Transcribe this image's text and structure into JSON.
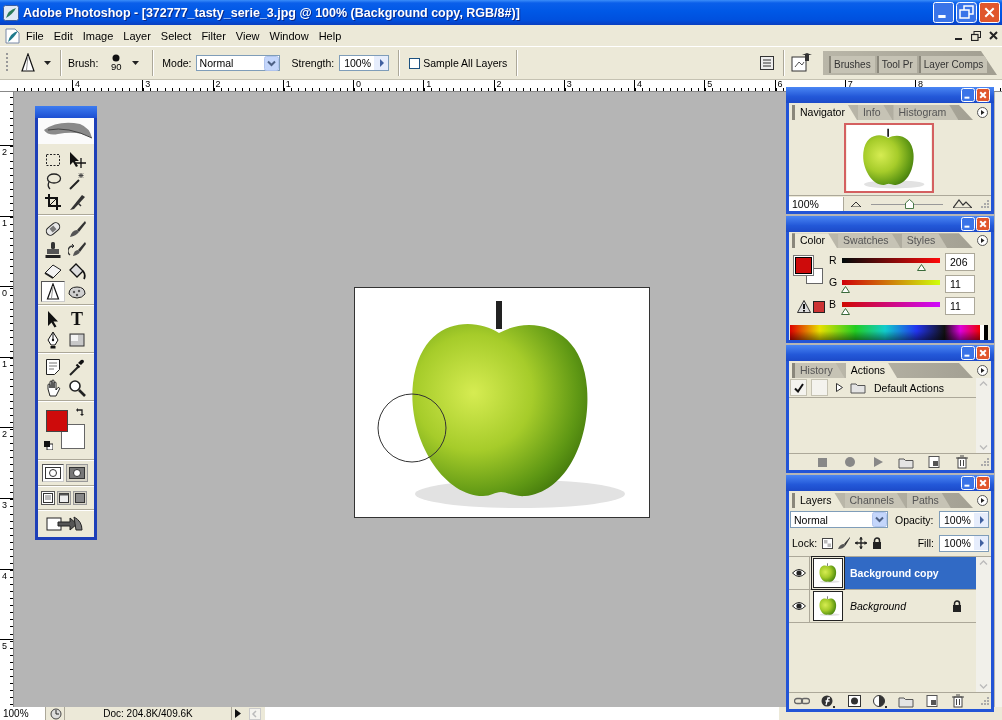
{
  "window": {
    "title": "Adobe Photoshop - [372777_tasty_serie_3.jpg @ 100% (Background copy, RGB/8#)]"
  },
  "menu_bar": {
    "items": [
      "File",
      "Edit",
      "Image",
      "Layer",
      "Select",
      "Filter",
      "View",
      "Window",
      "Help"
    ]
  },
  "options_bar": {
    "brush_label": "Brush:",
    "brush_size": "90",
    "mode_label": "Mode:",
    "mode": "Normal",
    "strength_label": "Strength:",
    "strength": "100%",
    "sample_all_layers": {
      "label": "Sample All Layers",
      "checked": false
    },
    "palette_well": {
      "tabs": [
        "Brushes",
        "Tool Pr",
        "Layer Comps"
      ]
    }
  },
  "rulers": {
    "horizontal": [
      "4",
      "3",
      "2",
      "1",
      "0",
      "1",
      "2",
      "3",
      "4",
      "5",
      "6",
      "7",
      "8"
    ],
    "vertical": [
      "2",
      "1",
      "0",
      "1",
      "2",
      "3",
      "4",
      "5"
    ]
  },
  "toolbox": {
    "tool_groups": [
      [
        {
          "kind": "marquee",
          "selected": false
        },
        {
          "kind": "move",
          "selected": false
        },
        {
          "kind": "lasso",
          "selected": false
        },
        {
          "kind": "wand",
          "selected": false
        },
        {
          "kind": "crop",
          "selected": false
        },
        {
          "kind": "slice",
          "selected": false
        }
      ],
      [
        {
          "kind": "healing",
          "selected": false
        },
        {
          "kind": "brush",
          "selected": false
        },
        {
          "kind": "stamp",
          "selected": false
        },
        {
          "kind": "history",
          "selected": false
        },
        {
          "kind": "eraser",
          "selected": false
        },
        {
          "kind": "bucket",
          "selected": false
        },
        {
          "kind": "sharpen",
          "selected": true
        },
        {
          "kind": "sponge",
          "selected": false
        }
      ],
      [
        {
          "kind": "pathselect",
          "selected": false
        },
        {
          "kind": "type",
          "selected": false,
          "glyph": "T"
        },
        {
          "kind": "pen",
          "selected": false
        },
        {
          "kind": "shape",
          "selected": false
        }
      ],
      [
        {
          "kind": "notes",
          "selected": false
        },
        {
          "kind": "eyedropper",
          "selected": false
        },
        {
          "kind": "hand",
          "selected": false
        },
        {
          "kind": "zoom",
          "selected": false
        }
      ]
    ],
    "colors": [
      {
        "kind": "foreground",
        "color": "#ce0b0b"
      },
      {
        "kind": "background",
        "color": "#ffffff"
      }
    ],
    "edit_modes": [
      {
        "kind": "standard",
        "selected": true
      },
      {
        "kind": "quickmask",
        "selected": false
      }
    ],
    "screen_modes": [
      {
        "kind": "window",
        "selected": true
      },
      {
        "kind": "fullmenu",
        "selected": false
      },
      {
        "kind": "full",
        "selected": false
      }
    ]
  },
  "navigator_panel": {
    "tabs": [
      {
        "label": "Navigator",
        "selected": true
      },
      {
        "label": "Info",
        "selected": false
      },
      {
        "label": "Histogram",
        "selected": false
      }
    ],
    "zoom": "100%",
    "zoom_slider": {
      "level": 0.53
    }
  },
  "color_panel": {
    "tabs": [
      {
        "label": "Color",
        "selected": true
      },
      {
        "label": "Swatches",
        "selected": false
      },
      {
        "label": "Styles",
        "selected": false
      }
    ],
    "swatches": [
      {
        "kind": "foreground",
        "color": "#ce0b0b"
      },
      {
        "kind": "background",
        "color": "#ffffff"
      }
    ],
    "channels": [
      {
        "name": "R",
        "level": 0.81,
        "value": "206"
      },
      {
        "name": "G",
        "level": 0.04,
        "value": "11"
      },
      {
        "name": "B",
        "level": 0.04,
        "value": "11"
      }
    ],
    "gamut_warning": {
      "color": "#cc3333"
    }
  },
  "actions_panel": {
    "tabs": [
      {
        "label": "History",
        "selected": false
      },
      {
        "label": "Actions",
        "selected": true
      }
    ],
    "items": [
      {
        "name": "Default Actions",
        "checked": true,
        "dialog": false,
        "expanded": false
      }
    ]
  },
  "layers_panel": {
    "tabs": [
      {
        "label": "Layers",
        "selected": true
      },
      {
        "label": "Channels",
        "selected": false
      },
      {
        "label": "Paths",
        "selected": false
      }
    ],
    "blend_mode": "Normal",
    "opacity_label": "Opacity:",
    "opacity": "100%",
    "lock_label": "Lock:",
    "fill_label": "Fill:",
    "fill": "100%",
    "layers": [
      {
        "name": "Background copy",
        "kind": "layer",
        "selected": true,
        "visible": true,
        "locked": false
      },
      {
        "name": "Background",
        "kind": "background",
        "selected": false,
        "visible": true,
        "locked": true
      }
    ]
  },
  "status_bar": {
    "zoom": "100%",
    "doc_info": "Doc: 204.8K/409.6K"
  }
}
